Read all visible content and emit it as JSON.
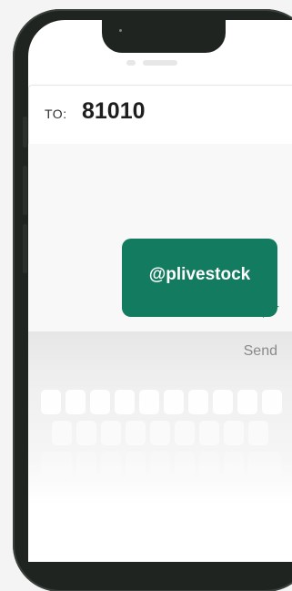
{
  "recipient": {
    "label": "TO:",
    "value": "81010"
  },
  "message": {
    "text": "@plivestock",
    "bubble_color": "#137b60"
  },
  "compose": {
    "send_label": "Send"
  },
  "icons": {
    "front_camera": "front-camera-icon"
  }
}
